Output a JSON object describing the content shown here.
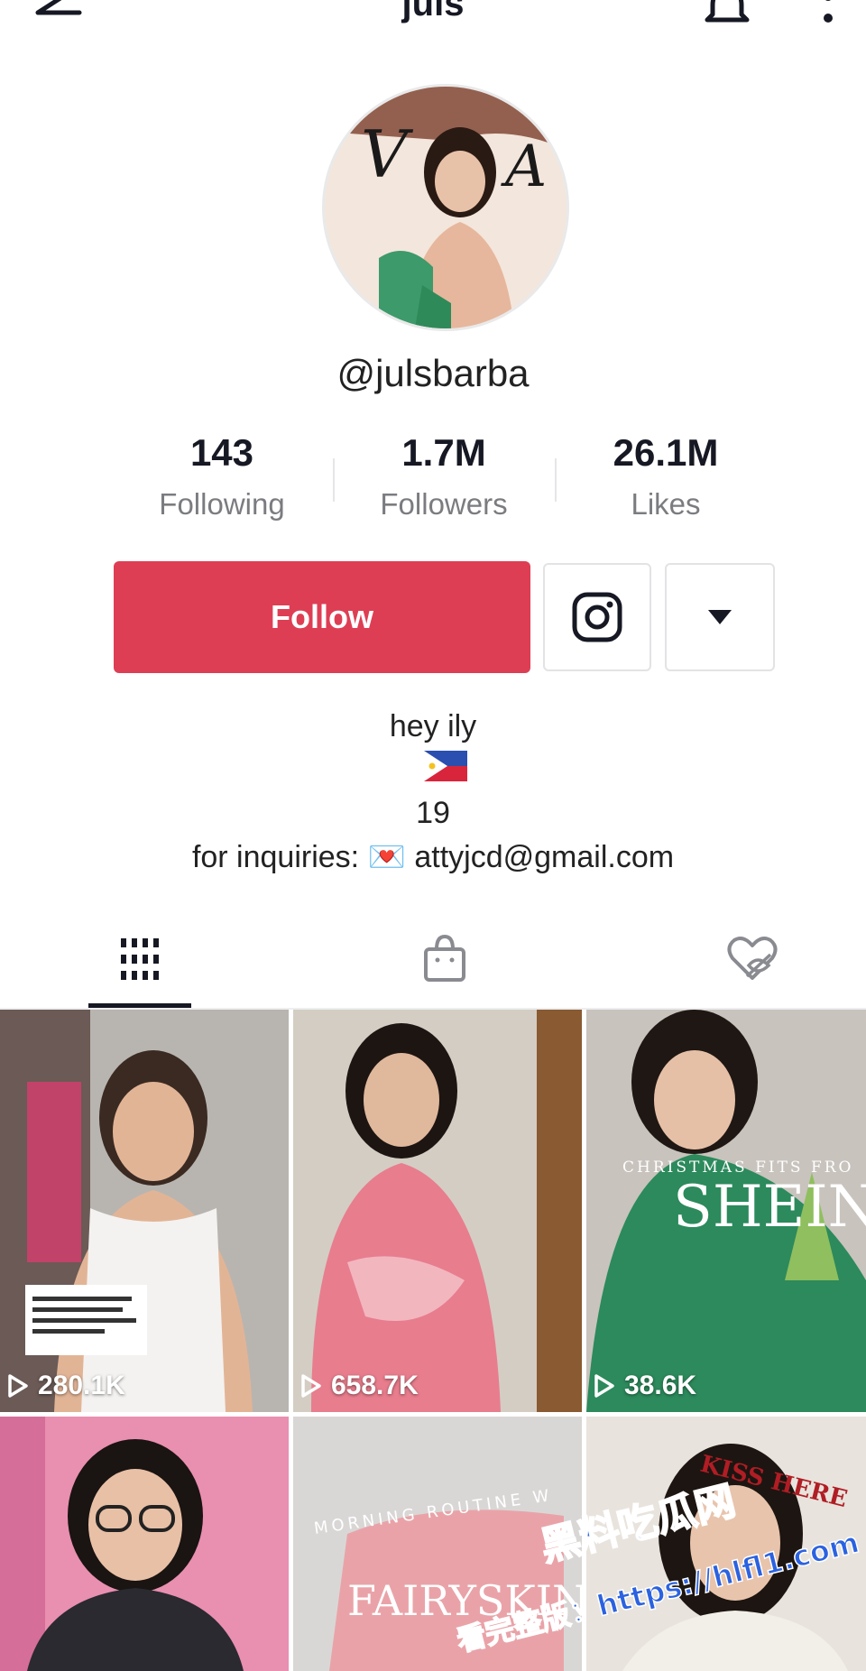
{
  "header": {
    "title": "juls"
  },
  "profile": {
    "username": "@julsbarba",
    "stats": [
      {
        "value": "143",
        "label": "Following"
      },
      {
        "value": "1.7M",
        "label": "Followers"
      },
      {
        "value": "26.1M",
        "label": "Likes"
      }
    ],
    "follow_label": "Follow",
    "bio": {
      "line1": "hey ily",
      "age": "19",
      "inquiries": "for inquiries: 💌 attyjcd@gmail.com"
    }
  },
  "tabs": [
    {
      "name": "videos",
      "icon": "grid-icon",
      "selected": true
    },
    {
      "name": "shop",
      "icon": "shopping-bag-icon",
      "selected": false
    },
    {
      "name": "liked",
      "icon": "hidden-heart-icon",
      "selected": false
    }
  ],
  "videos": [
    {
      "views": "280.1K",
      "caption_tag": "NADAANAN KITA KANINA SA CAMPUS (U schoolmate) and super bango mo girl grabe! PERFUME REVEAL ASAP PLEASE 😂😂"
    },
    {
      "views": "658.7K"
    },
    {
      "views": "38.6K",
      "overlay_text": "SHEIN",
      "overlay_sub": "CHRISTMAS FITS FRO"
    },
    {
      "views": ""
    },
    {
      "views": "",
      "overlay_text": "FAIRYSKIN",
      "overlay_sub": "MORNING ROUTINE W"
    },
    {
      "views": "",
      "overlay_text": "KISS HERE"
    }
  ],
  "watermark": {
    "line1": "黑料吃瓜网",
    "line2": "看完整版：https://hlfl1.com"
  },
  "colors": {
    "follow": "#de3e54",
    "text": "#161823",
    "muted": "#7b7c80"
  }
}
